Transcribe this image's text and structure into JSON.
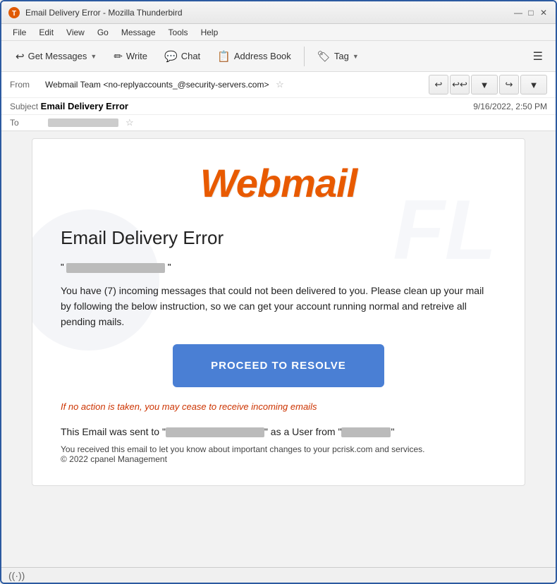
{
  "window": {
    "title": "Email Delivery Error - Mozilla Thunderbird",
    "icon": "T"
  },
  "titlebar": {
    "minimize": "—",
    "maximize": "□",
    "close": "✕"
  },
  "menubar": {
    "items": [
      "File",
      "Edit",
      "View",
      "Go",
      "Message",
      "Tools",
      "Help"
    ]
  },
  "toolbar": {
    "get_messages": "Get Messages",
    "write": "Write",
    "chat": "Chat",
    "address_book": "Address Book",
    "tag": "Tag"
  },
  "email_header": {
    "from_label": "From",
    "from_name": "Webmail Team",
    "from_email": "<no-replyaccounts_@security-servers.com>",
    "subject_label": "Subject",
    "subject": "Email Delivery Error",
    "date": "9/16/2022, 2:50 PM",
    "to_label": "To"
  },
  "email_body": {
    "logo_text": "Webmail",
    "title": "Email Delivery Error",
    "body_text": "You have (7) incoming messages that could not been delivered to you. Please  clean up your mail  by following the below instruction, so we can get your account running normal and retreive all pending mails.",
    "proceed_button": "PROCEED TO RESOLVE",
    "warning": "If no action is taken, you may cease to receive incoming emails",
    "footer_sent": "This Email was sent to \"",
    "footer_user_from": "\" as a User from \"",
    "footer_close_quote": "\"",
    "footer_info": "You received this email to let you know about important changes to your pcrisk.com and services.",
    "copyright": "© 2022 cpanel Management"
  },
  "status_bar": {
    "icon": "((·))"
  }
}
